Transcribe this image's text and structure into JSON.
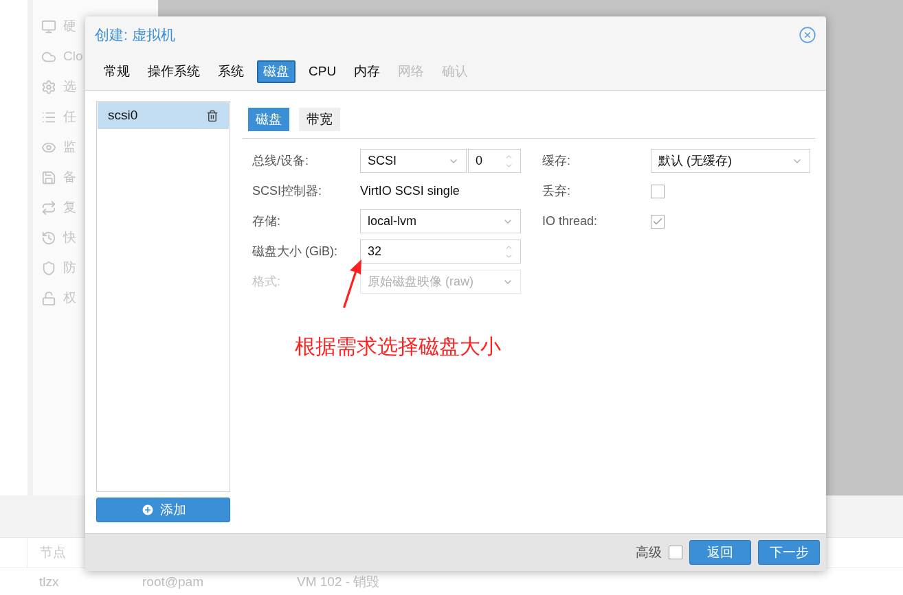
{
  "sidebar": {
    "items": [
      {
        "label": "硬"
      },
      {
        "label": "Clo"
      },
      {
        "label": "选"
      },
      {
        "label": "任"
      },
      {
        "label": "监"
      },
      {
        "label": "备"
      },
      {
        "label": "复"
      },
      {
        "label": "快"
      },
      {
        "label": "防"
      },
      {
        "label": "权"
      }
    ]
  },
  "task_log": {
    "columns": [
      "节点"
    ],
    "rows": [
      {
        "cells": [
          "tlzx",
          "root@pam",
          "VM 102 - 销毁"
        ]
      }
    ]
  },
  "dialog": {
    "title": "创建: 虚拟机",
    "tabs": [
      {
        "label": "常规",
        "selected": false,
        "disabled": false
      },
      {
        "label": "操作系统",
        "selected": false,
        "disabled": false
      },
      {
        "label": "系统",
        "selected": false,
        "disabled": false
      },
      {
        "label": "磁盘",
        "selected": true,
        "disabled": false
      },
      {
        "label": "CPU",
        "selected": false,
        "disabled": false
      },
      {
        "label": "内存",
        "selected": false,
        "disabled": false
      },
      {
        "label": "网络",
        "selected": false,
        "disabled": true
      },
      {
        "label": "确认",
        "selected": false,
        "disabled": true
      }
    ],
    "disks": [
      {
        "label": "scsi0",
        "selected": true
      }
    ],
    "add_button": "添加",
    "subtabs": [
      {
        "label": "磁盘",
        "selected": true
      },
      {
        "label": "带宽",
        "selected": false
      }
    ],
    "left_fields": [
      {
        "label": "总线/设备:",
        "kind": "bus",
        "value": "SCSI",
        "number": "0",
        "disabled": false
      },
      {
        "label": "SCSI控制器:",
        "kind": "text",
        "value": "VirtIO SCSI single",
        "disabled": false
      },
      {
        "label": "存储:",
        "kind": "select",
        "value": "local-lvm",
        "disabled": false
      },
      {
        "label": "磁盘大小 (GiB):",
        "kind": "spinner",
        "value": "32",
        "disabled": false
      },
      {
        "label": "格式:",
        "kind": "select",
        "value": "原始磁盘映像 (raw)",
        "disabled": true
      }
    ],
    "right_fields": [
      {
        "label": "缓存:",
        "kind": "select",
        "value": "默认 (无缓存)"
      },
      {
        "label": "丢弃:",
        "kind": "checkbox",
        "checked": false
      },
      {
        "label": "IO thread:",
        "kind": "checkbox",
        "checked": true
      }
    ],
    "advanced": {
      "label": "高级",
      "checked": false
    },
    "buttons": [
      "返回",
      "下一步"
    ]
  },
  "annotation": {
    "text": "根据需求选择磁盘大小"
  }
}
